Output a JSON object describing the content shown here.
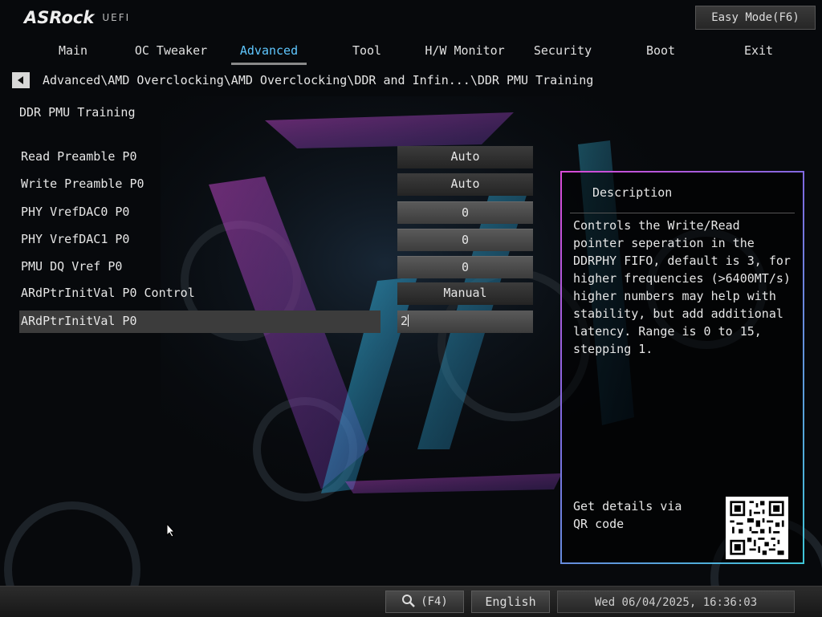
{
  "header": {
    "brand": "ASRock",
    "product": "UEFI",
    "easy_mode_label": "Easy Mode(F6)"
  },
  "tabs": [
    {
      "label": "Main",
      "active": false
    },
    {
      "label": "OC Tweaker",
      "active": false
    },
    {
      "label": "Advanced",
      "active": true
    },
    {
      "label": "Tool",
      "active": false
    },
    {
      "label": "H/W Monitor",
      "active": false
    },
    {
      "label": "Security",
      "active": false
    },
    {
      "label": "Boot",
      "active": false
    },
    {
      "label": "Exit",
      "active": false
    }
  ],
  "breadcrumb": "Advanced\\AMD Overclocking\\AMD Overclocking\\DDR and Infin...\\DDR PMU Training",
  "page_title": "DDR PMU Training",
  "settings": [
    {
      "label": "Read Preamble P0",
      "value": "Auto"
    },
    {
      "label": "Write Preamble P0",
      "value": "Auto"
    },
    {
      "label": "PHY VrefDAC0 P0",
      "value": "0"
    },
    {
      "label": "PHY VrefDAC1 P0",
      "value": "0"
    },
    {
      "label": "PMU DQ Vref P0",
      "value": "0"
    },
    {
      "label": "ARdPtrInitVal P0 Control",
      "value": "Manual"
    },
    {
      "label": "ARdPtrInitVal P0",
      "value": "2"
    }
  ],
  "description": {
    "title": "Description",
    "body": "Controls the Write/Read pointer seperation in the DDRPHY FIFO, default is 3, for higher frequencies (>6400MT/s) higher numbers may help with stability, but add additional latency. Range is 0 to 15, stepping 1.",
    "qr_text": "Get details via QR code"
  },
  "bottom": {
    "search_key": "(F4)",
    "language": "English",
    "datetime": "Wed 06/04/2025, 16:36:03"
  },
  "colors": {
    "accent": "#5fc7ff",
    "panel_border_start": "#d94ad6",
    "panel_border_end": "#3fc6d8"
  }
}
